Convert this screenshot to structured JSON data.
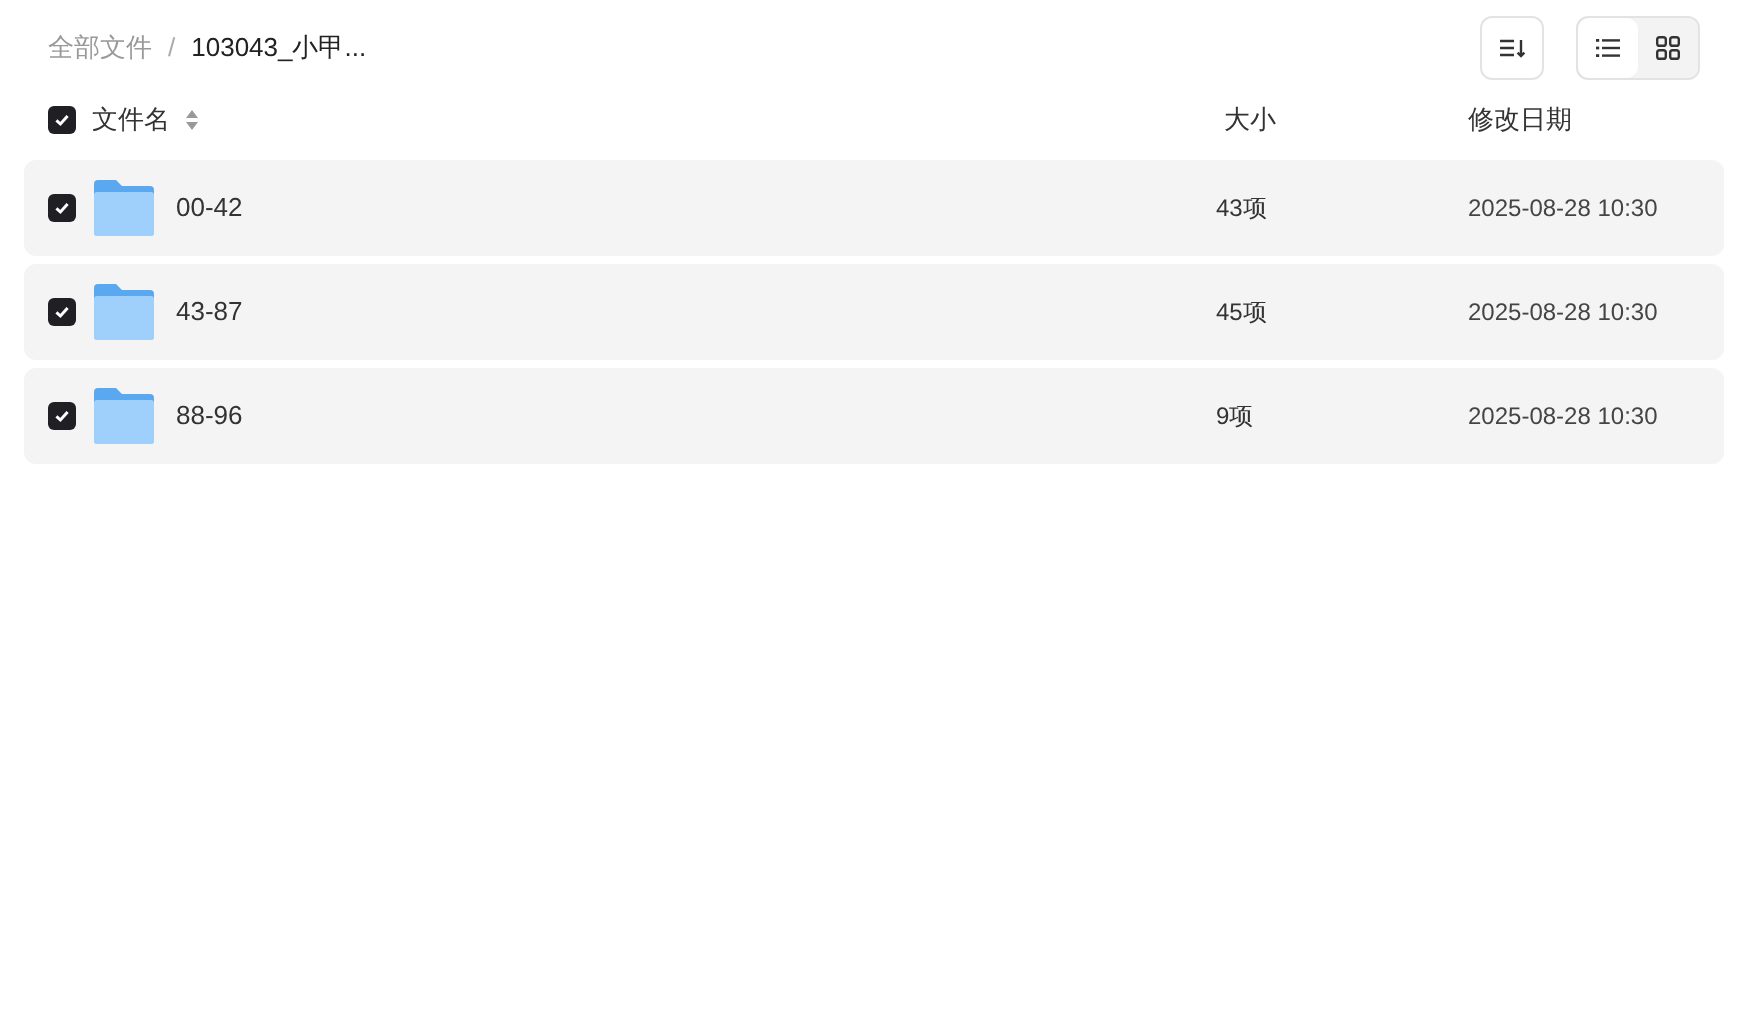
{
  "breadcrumb_separator": "/",
  "breadcrumb": [
    {
      "label": "全部文件",
      "current": false
    },
    {
      "label": "103043_小甲...",
      "current": true
    }
  ],
  "view_toggle": [
    {
      "kind": "list",
      "selected": true
    },
    {
      "kind": "grid",
      "selected": false
    }
  ],
  "table": {
    "select_all": {
      "checked": true
    },
    "columns": [
      "文件名",
      "大小",
      "修改日期"
    ],
    "rows": [
      {
        "checked": true,
        "name": "00-42",
        "size": "43项",
        "modified": "2025-08-28 10:30"
      },
      {
        "checked": true,
        "name": "43-87",
        "size": "45项",
        "modified": "2025-08-28 10:30"
      },
      {
        "checked": true,
        "name": "88-96",
        "size": "9项",
        "modified": "2025-08-28 10:30"
      }
    ]
  }
}
